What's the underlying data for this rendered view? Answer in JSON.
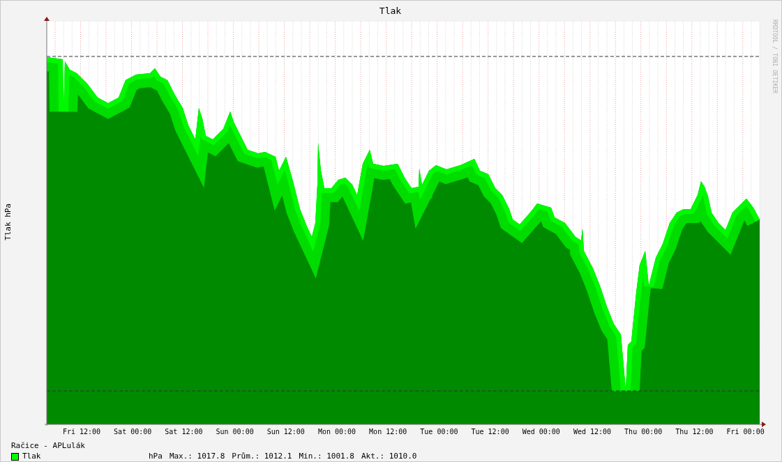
{
  "title": "Tlak",
  "y_axis_label": "Tlak hPa",
  "credit": "RRDTOOL / TOBI OETIKER",
  "x_labels": [
    "Fri 12:00",
    "Sat 00:00",
    "Sat 12:00",
    "Sun 00:00",
    "Sun 12:00",
    "Mon 00:00",
    "Mon 12:00",
    "Tue 00:00",
    "Tue 12:00",
    "Wed 00:00",
    "Wed 12:00",
    "Thu 00:00",
    "Thu 12:00",
    "Fri 00:00"
  ],
  "legend": {
    "location": "Račice - APLulák",
    "series": [
      {
        "name": "Tlak",
        "color": "#00ff00",
        "unit": "hPa",
        "max": "Max.: 1017.8",
        "avg": "Prům.: 1012.1",
        "min": "Min.: 1001.8",
        "current": "Akt.: 1010.0"
      }
    ]
  }
}
